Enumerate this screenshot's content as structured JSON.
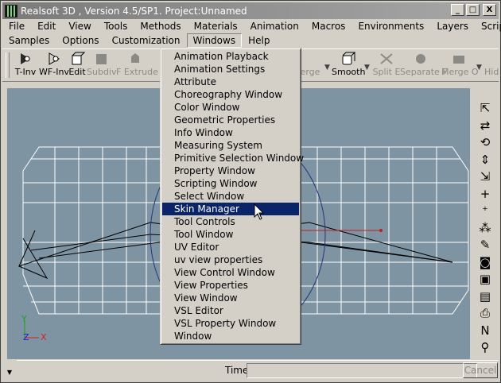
{
  "window": {
    "title": "Realsoft 3D , Version 4.5/SP1. Project:Unnamed",
    "buttons": [
      "_",
      "□",
      "X"
    ]
  },
  "menubar": {
    "row1": [
      "File",
      "Edit",
      "View",
      "Tools",
      "Methods",
      "Materials",
      "Animation",
      "Macros",
      "Environments",
      "Layers",
      "Scripts"
    ],
    "row2": [
      "Samples",
      "Options",
      "Customization",
      "Windows",
      "Help"
    ],
    "active": "Windows"
  },
  "toolbar": {
    "tools": [
      {
        "label": "T-Inv",
        "icon": "eye-icon",
        "enabled": true
      },
      {
        "label": "WF-Inv",
        "icon": "eye-wireframe-icon",
        "enabled": true
      },
      {
        "label": "Edit",
        "icon": "cube-edit-icon",
        "enabled": true
      },
      {
        "label": "Subdiv",
        "icon": "subdiv-icon",
        "enabled": false
      },
      {
        "label": "F Extrude",
        "icon": "extrude-icon",
        "enabled": false
      },
      {
        "label": "erge",
        "icon": "merge-icon",
        "enabled": false
      },
      {
        "label": "Smooth",
        "icon": "smooth-cube-icon",
        "enabled": true
      },
      {
        "label": "Split E",
        "icon": "split-edge-icon",
        "enabled": false
      },
      {
        "label": "Separate F",
        "icon": "separate-face-icon",
        "enabled": false
      },
      {
        "label": "Merge O",
        "icon": "merge-objects-icon",
        "enabled": false
      },
      {
        "label": "Hid",
        "icon": "hide-icon",
        "enabled": false
      }
    ]
  },
  "windows_menu": {
    "items": [
      "Animation Playback",
      "Animation Settings",
      "Attribute",
      "Choreography Window",
      "Color Window",
      "Geometric Properties",
      "Info Window",
      "Measuring System",
      "Primitive Selection Window",
      "Property Window",
      "Scripting Window",
      "Select Window",
      "Skin Manager",
      "Tool Controls",
      "Tool Window",
      "UV Editor",
      "uv view properties",
      "View Control Window",
      "View Properties",
      "View Window",
      "VSL Editor",
      "VSL Property Window",
      "Window"
    ],
    "highlighted_index": 12
  },
  "statusbar": {
    "time_label": "Time:",
    "time_value": "",
    "cancel_label": "Cancel"
  },
  "viewport": {
    "axis_labels": {
      "y": "Y",
      "z": "Z",
      "x": "X"
    },
    "background": "#7f94a2",
    "wire_color": "#ffffff"
  },
  "right_tools": [
    {
      "icon": "select-arrow-icon",
      "glyph": "⇱"
    },
    {
      "icon": "move-icon",
      "glyph": "⇄"
    },
    {
      "icon": "rotate-icon",
      "glyph": "⟲"
    },
    {
      "icon": "scale-vertical-icon",
      "glyph": "⇕"
    },
    {
      "icon": "scale-icon",
      "glyph": "⇲"
    },
    {
      "icon": "add-point-icon",
      "glyph": "+"
    },
    {
      "icon": "add-points-icon",
      "glyph": "⁺"
    },
    {
      "icon": "multi-add-icon",
      "glyph": "⁂"
    },
    {
      "icon": "paint-icon",
      "glyph": "✎"
    },
    {
      "icon": "camera-icon",
      "glyph": "◙"
    },
    {
      "icon": "render-icon",
      "glyph": "▣"
    },
    {
      "icon": "render-window-icon",
      "glyph": "▤"
    },
    {
      "icon": "printer-icon",
      "glyph": "⎙"
    },
    {
      "icon": "navigate-icon",
      "glyph": "N"
    },
    {
      "icon": "zoom-icon",
      "glyph": "⚲"
    }
  ]
}
